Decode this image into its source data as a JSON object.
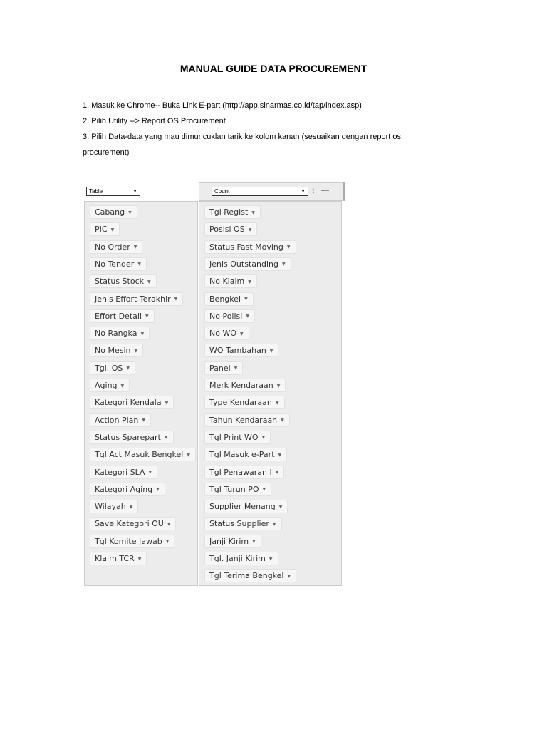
{
  "title": "MANUAL GUIDE DATA PROCUREMENT",
  "steps": [
    "1. Masuk ke Chrome-- Buka Link E-part (http://app.sinarmas.co.id/tap/index.asp)",
    "2. Pilih Utility --> Report OS Procurement",
    "3. Pilih Data-data yang mau dimuncuklan tarik ke kolom kanan (sesuaikan dengan report os procurement)"
  ],
  "screenshot": {
    "left_select": "Table",
    "right_select": "Count",
    "left_fields": [
      "Cabang",
      "PIC",
      "No Order",
      "No Tender",
      "Status Stock",
      "Jenis Effort Terakhir",
      "Effort Detail",
      "No Rangka",
      "No Mesin",
      "Tgl. OS",
      "Aging",
      "Kategori Kendala",
      "Action Plan",
      "Status Sparepart",
      "Tgl Act Masuk Bengkel",
      "Kategori SLA",
      "Kategori Aging",
      "Wilayah",
      "Save Kategori OU",
      "Tgl Komite Jawab",
      "Klaim TCR"
    ],
    "right_fields": [
      "Tgl Regist",
      "Posisi OS",
      "Status Fast Moving",
      "Jenis Outstanding",
      "No Klaim",
      "Bengkel",
      "No Polisi",
      "No WO",
      "WO Tambahan",
      "Panel",
      "Merk Kendaraan",
      "Type Kendaraan",
      "Tahun Kendaraan",
      "Tgl Print WO",
      "Tgl Masuk e-Part",
      "Tgl Penawaran I",
      "Tgl Turun PO",
      "Supplier Menang",
      "Status Supplier",
      "Janji Kirim",
      "Tgl. Janji Kirim",
      "Tgl Terima Bengkel"
    ]
  }
}
